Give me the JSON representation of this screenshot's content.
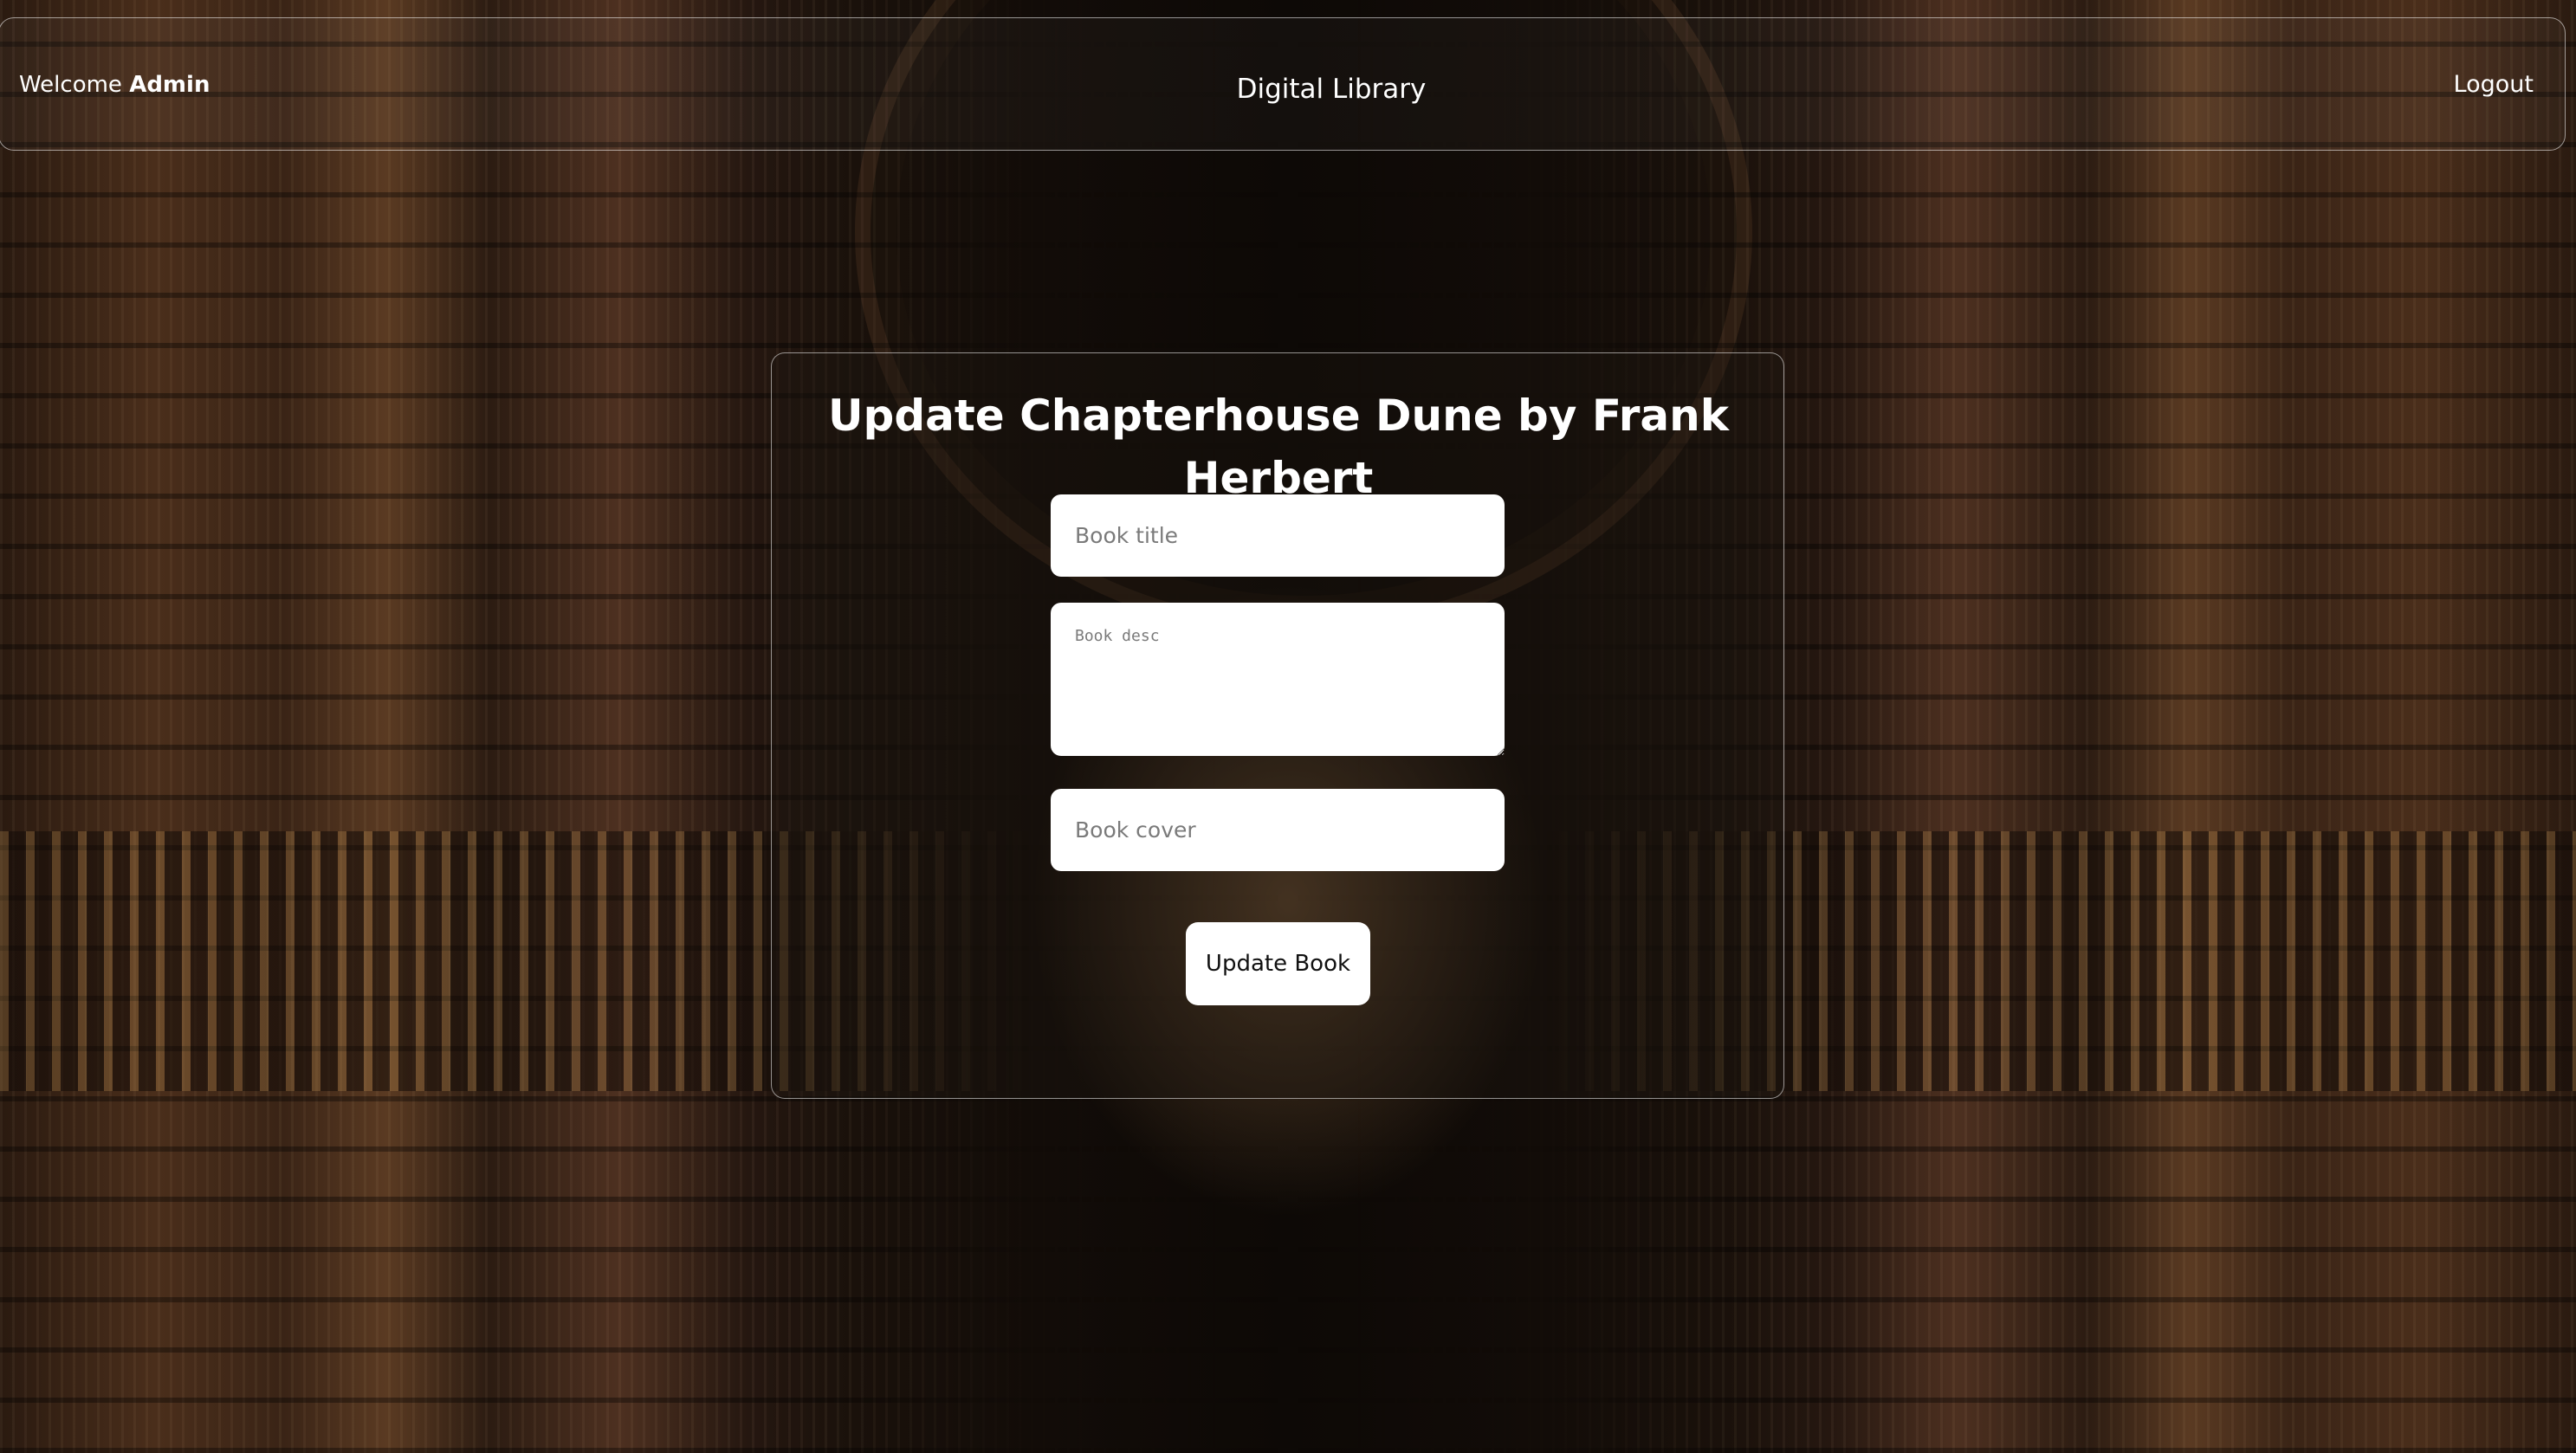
{
  "header": {
    "welcome_prefix": "Welcome",
    "username": "Admin",
    "brand": "Digital Library",
    "logout_label": "Logout"
  },
  "form": {
    "heading": "Update Chapterhouse Dune by Frank Herbert",
    "title_value": "",
    "title_placeholder": "Book title",
    "desc_value": "",
    "desc_placeholder": "Book desc",
    "cover_value": "",
    "cover_placeholder": "Book cover",
    "submit_label": "Update Book"
  },
  "colors": {
    "text": "#ffffff",
    "field_background": "#ffffff",
    "button_background": "#ffffff",
    "button_text": "#111111"
  }
}
